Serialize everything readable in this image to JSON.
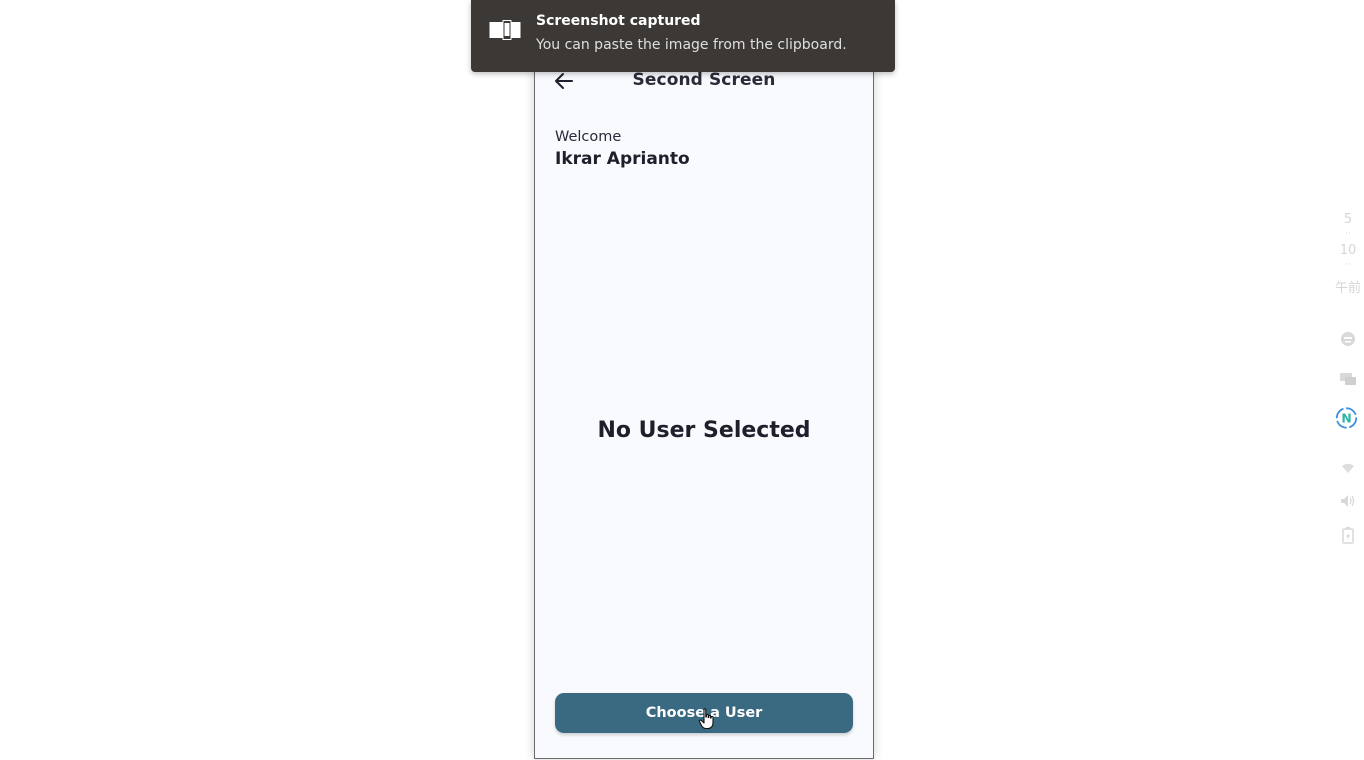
{
  "toast": {
    "title": "Screenshot captured",
    "body": "You can paste the image from the clipboard.",
    "icon": "screenshot-icon"
  },
  "appbar": {
    "title": "Second Screen",
    "back_icon": "arrow-left-icon"
  },
  "welcome": {
    "label": "Welcome",
    "name": "Ikrar Aprianto"
  },
  "main": {
    "empty_message": "No User Selected"
  },
  "actions": {
    "choose_label": "Choose a User",
    "accent_color": "#3a6a82"
  },
  "tray": {
    "hour": "5",
    "minute": "10",
    "period": "午前",
    "icons": [
      "emoji-icon",
      "chat-icon",
      "network-n-icon",
      "wifi-icon",
      "volume-icon",
      "battery-icon"
    ]
  }
}
